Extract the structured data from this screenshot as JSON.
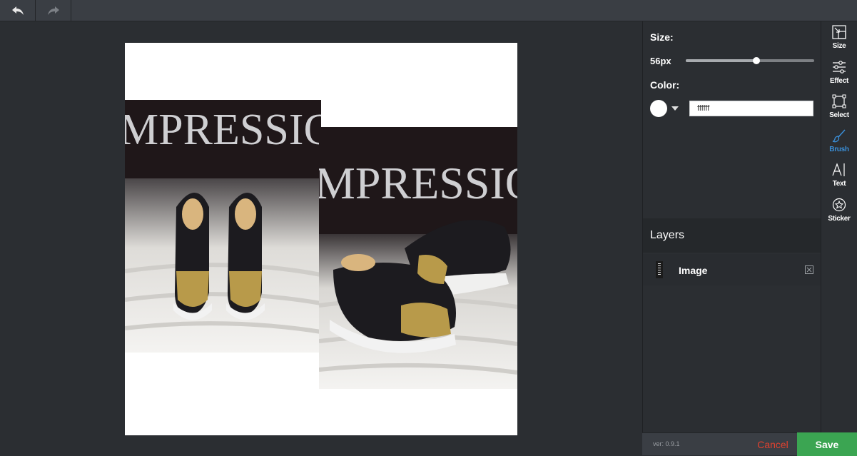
{
  "topbar": {
    "undo_icon": "undo-arrow-icon",
    "redo_icon": "redo-arrow-icon"
  },
  "canvas": {
    "background": "#ffffff",
    "photo_text": "MPRESSIO"
  },
  "panel": {
    "size_label": "Size:",
    "size_value": "56px",
    "size_slider_fraction": 0.55,
    "color_label": "Color:",
    "color_value": "ffffff",
    "color_swatch": "#ffffff"
  },
  "layers": {
    "title": "Layers",
    "items": [
      {
        "name": "Image"
      }
    ]
  },
  "footer": {
    "version": "ver: 0.9.1",
    "cancel_label": "Cancel",
    "save_label": "Save"
  },
  "colors": {
    "accent": "#3a8fd8",
    "save": "#3ba552",
    "cancel": "#e0412f"
  },
  "tools": [
    {
      "label": "Size",
      "icon": "resize-icon"
    },
    {
      "label": "Effect",
      "icon": "sliders-icon"
    },
    {
      "label": "Select",
      "icon": "select-box-icon"
    },
    {
      "label": "Brush",
      "icon": "brush-icon",
      "active": true
    },
    {
      "label": "Text",
      "icon": "text-cursor-icon"
    },
    {
      "label": "Sticker",
      "icon": "sticker-star-icon"
    }
  ]
}
